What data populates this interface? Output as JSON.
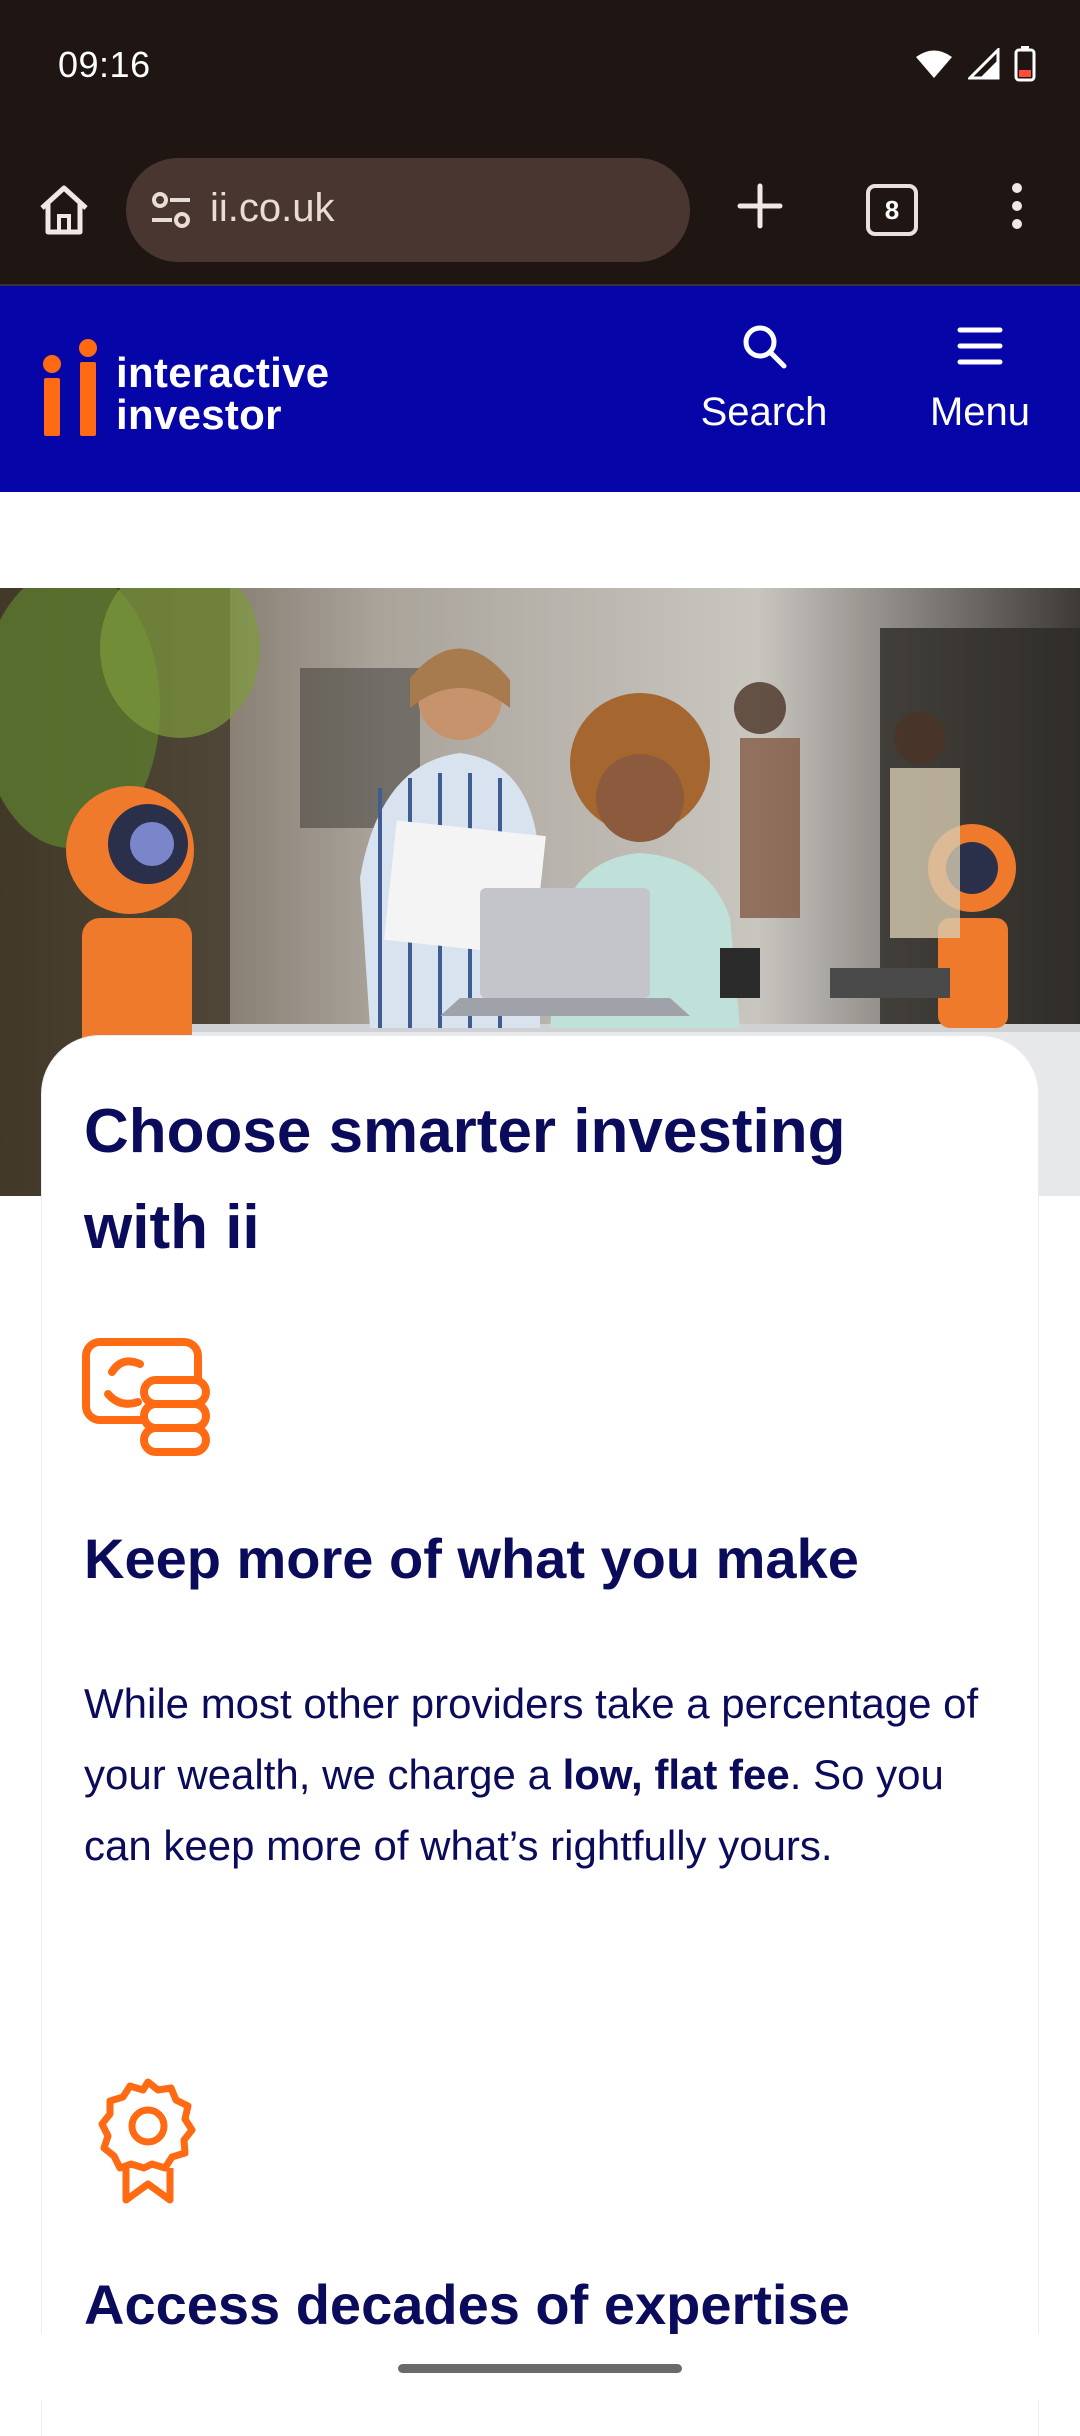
{
  "status": {
    "time": "09:16"
  },
  "browser": {
    "url": "ii.co.uk",
    "tab_count": "8"
  },
  "header": {
    "logo_line1": "interactive",
    "logo_line2": "investor",
    "search_label": "Search",
    "menu_label": "Menu"
  },
  "card": {
    "title": "Choose smarter investing with ii",
    "features": [
      {
        "icon": "money-coins-icon",
        "title": "Keep more of what you make",
        "body_before": "While most other providers take a percentage of your wealth, we charge a ",
        "body_bold": "low, flat fee",
        "body_after": ". So you can keep more of what’s rightfully yours."
      },
      {
        "icon": "award-rosette-icon",
        "title": "Access decades of expertise"
      }
    ]
  },
  "colors": {
    "brand_blue": "#0505a8",
    "brand_orange": "#ff6a13",
    "heading_navy": "#0b0b5c",
    "browser_chrome": "#1f1614"
  }
}
